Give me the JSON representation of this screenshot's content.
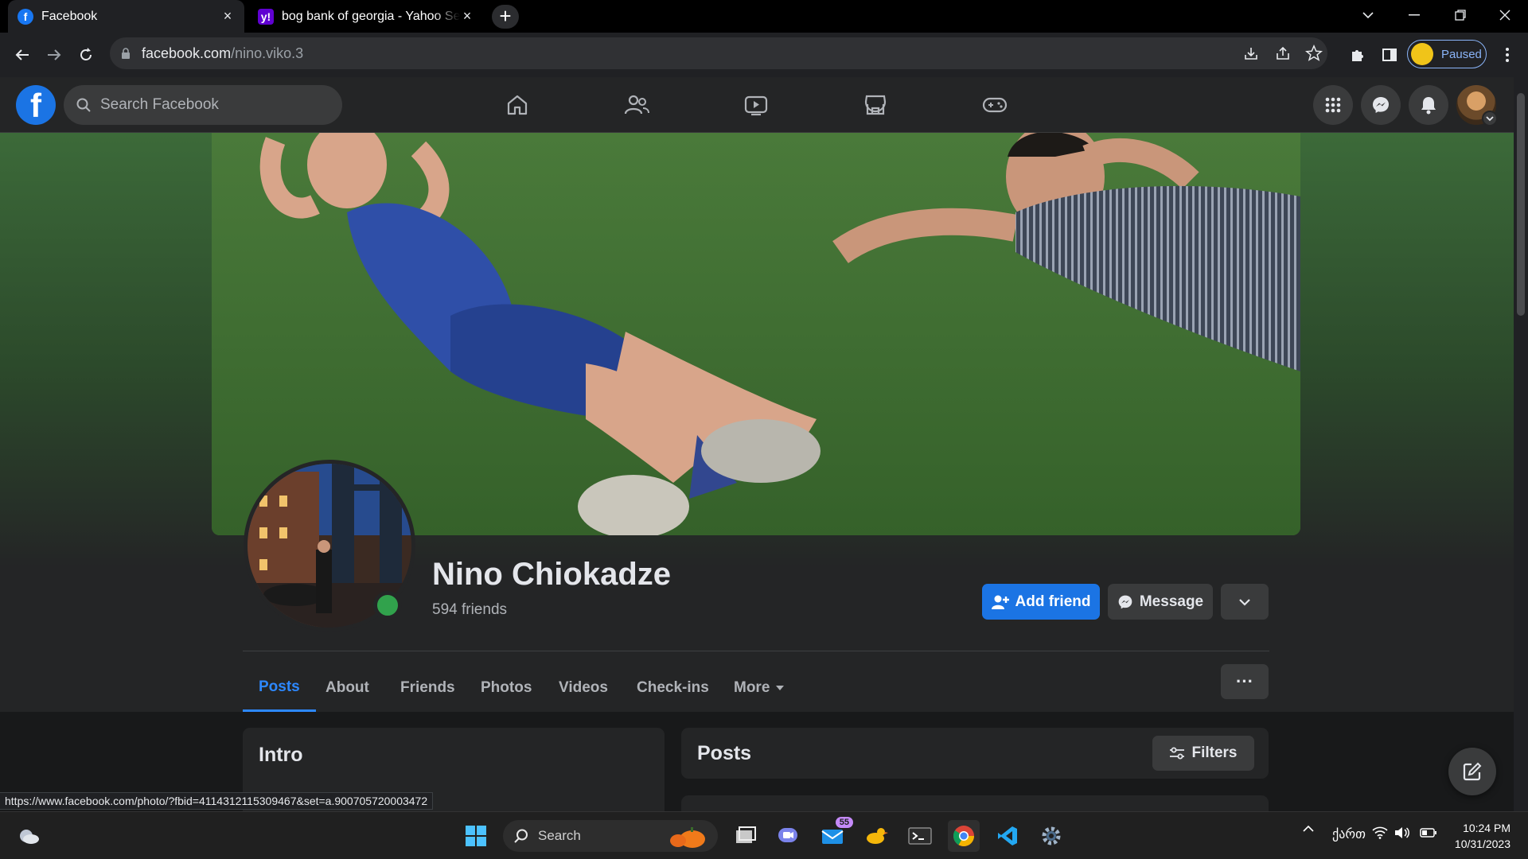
{
  "browser": {
    "tabs": [
      {
        "title": "Facebook",
        "close": "×"
      },
      {
        "title": "bog bank of georgia - Yahoo Se",
        "close": "×"
      }
    ],
    "new_tab": "+",
    "url_host": "facebook.com",
    "url_path": "/nino.viko.3",
    "profile_status": "Paused"
  },
  "facebook": {
    "logo": "f",
    "search_placeholder": "Search Facebook"
  },
  "profile": {
    "name": "Nino Chiokadze",
    "friends": "594 friends",
    "add_friend": "Add friend",
    "message": "Message",
    "tabs": [
      "Posts",
      "About",
      "Friends",
      "Photos",
      "Videos",
      "Check-ins",
      "More"
    ],
    "more_dots": "···"
  },
  "intro": {
    "title": "Intro"
  },
  "posts": {
    "title": "Posts",
    "filters": "Filters"
  },
  "status_url": "https://www.facebook.com/photo/?fbid=4114312115309467&set=a.900705720003472",
  "taskbar": {
    "search": "Search",
    "mail_badge": "55",
    "lang": "ქართ",
    "time": "10:24 PM",
    "date": "10/31/2023"
  },
  "colors": {
    "accent": "#1b74e4",
    "tab_active": "#2d88ff",
    "online": "#31a24c"
  }
}
